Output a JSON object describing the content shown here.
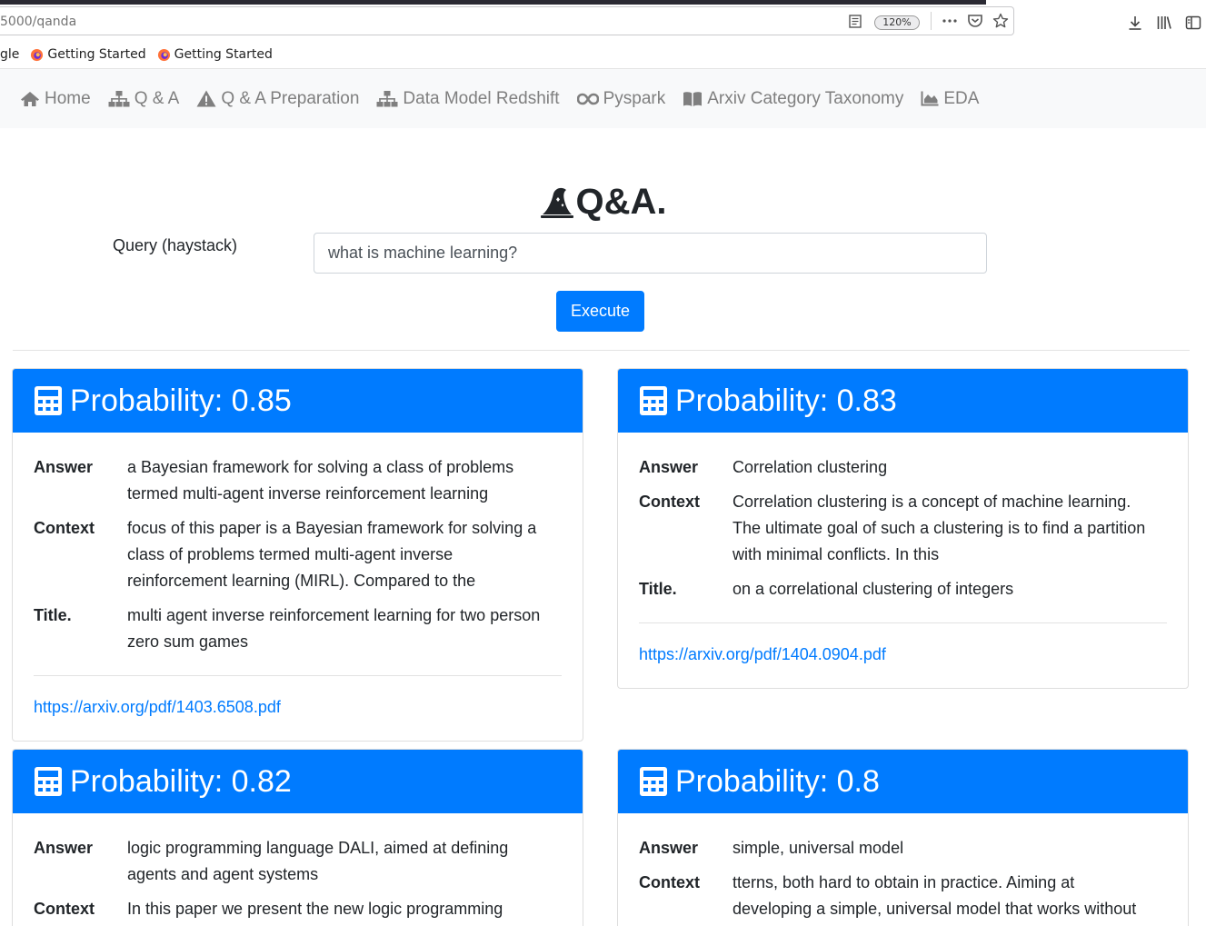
{
  "browser": {
    "url": "5000/qanda",
    "zoom": "120%",
    "bookmarks": [
      {
        "label": "gle"
      },
      {
        "label": "Getting Started"
      },
      {
        "label": "Getting Started"
      }
    ]
  },
  "nav": {
    "items": [
      {
        "label": "Home",
        "icon": "home-icon"
      },
      {
        "label": "Q & A",
        "icon": "sitemap-icon"
      },
      {
        "label": "Q & A Preparation",
        "icon": "warning-icon"
      },
      {
        "label": "Data Model Redshift",
        "icon": "sitemap-icon"
      },
      {
        "label": "Pyspark",
        "icon": "infinity-icon"
      },
      {
        "label": "Arxiv Category Taxonomy",
        "icon": "book-icon"
      },
      {
        "label": "EDA",
        "icon": "area-chart-icon"
      }
    ]
  },
  "page": {
    "title": "Q&A.",
    "query_label": "Query (haystack)",
    "query_value": "what is machine learning?",
    "execute_label": "Execute"
  },
  "labels": {
    "answer": "Answer",
    "context": "Context",
    "title": "Title."
  },
  "results": [
    {
      "header": "Probability: 0.85",
      "answer": "a Bayesian framework for solving a class of problems termed multi-agent inverse reinforcement learning",
      "context": "focus of this paper is a Bayesian framework for solving a class of problems termed multi-agent inverse reinforcement learning (MIRL). Compared to the",
      "title": "multi agent inverse reinforcement learning for two person zero sum games",
      "link": "https://arxiv.org/pdf/1403.6508.pdf"
    },
    {
      "header": "Probability: 0.83",
      "answer": "Correlation clustering",
      "context": "Correlation clustering is a concept of machine learning. The ultimate goal of such a clustering is to find a partition with minimal conflicts. In this",
      "title": "on a correlational clustering of integers",
      "link": "https://arxiv.org/pdf/1404.0904.pdf"
    },
    {
      "header": "Probability: 0.82",
      "answer": "logic programming language DALI, aimed at defining agents and agent systems",
      "context": "In this paper we present the new logic programming"
    },
    {
      "header": "Probability: 0.8",
      "answer": "simple, universal model",
      "context": "tterns, both hard to obtain in practice. Aiming at developing a simple, universal model that works without"
    }
  ],
  "colors": {
    "primary": "#007bff",
    "navbar_bg": "#f8f9fa",
    "nav_text": "#7f7f7f"
  }
}
